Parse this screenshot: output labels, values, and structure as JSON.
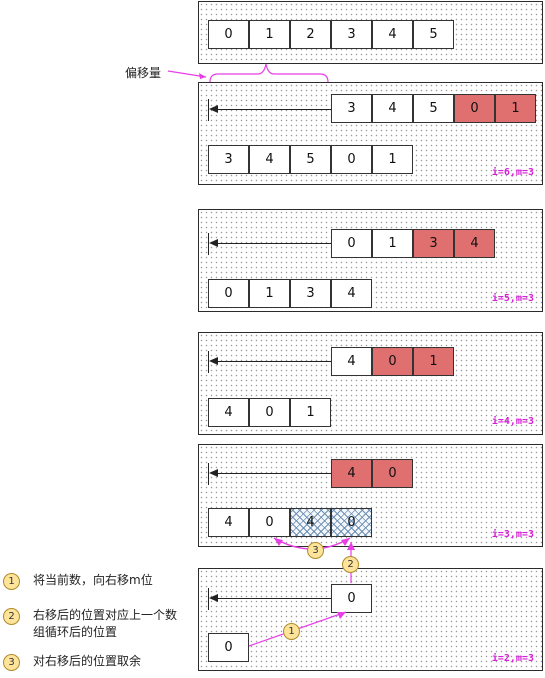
{
  "top_array": [
    "0",
    "1",
    "2",
    "3",
    "4",
    "5"
  ],
  "offset_label": "偏移量",
  "steps": [
    {
      "tag": "i=6,m=3",
      "shifted": [
        "3",
        "4",
        "5",
        "0",
        "1"
      ],
      "result": [
        "3",
        "4",
        "5",
        "0",
        "1"
      ]
    },
    {
      "tag": "i=5,m=3",
      "shifted": [
        "0",
        "1",
        "3",
        "4"
      ],
      "result": [
        "0",
        "1",
        "3",
        "4"
      ]
    },
    {
      "tag": "i=4,m=3",
      "shifted": [
        "4",
        "0",
        "1"
      ],
      "result": [
        "4",
        "0",
        "1"
      ]
    },
    {
      "tag": "i=3,m=3",
      "shifted": [
        "4",
        "0"
      ],
      "result": [
        "4",
        "0",
        "4",
        "0"
      ]
    },
    {
      "tag": "i=2,m=3",
      "shifted": [
        "0"
      ],
      "result": [
        "0"
      ]
    }
  ],
  "badges": [
    "1",
    "2",
    "3"
  ],
  "legend": [
    {
      "num": "1",
      "text": "将当前数，向右移m位"
    },
    {
      "num": "2",
      "text": "右移后的位置对应上一个数组循环后的位置"
    },
    {
      "num": "3",
      "text": "对右移后的位置取余"
    }
  ],
  "colors": {
    "highlight": "#e07070",
    "tag": "#d61fd6",
    "magenta": "#e83ee8",
    "badge": "#fde49a"
  }
}
